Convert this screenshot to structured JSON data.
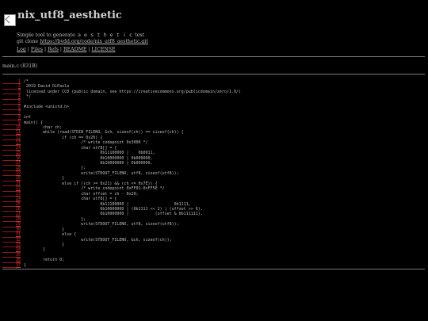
{
  "header": {
    "title": "nix_utf8_aesthetic",
    "description": "Simple tool to generate ａ ｅ ｓ ｔ ｈ ｅ ｔ ｉ ｃ text",
    "clone_prefix": "git clone",
    "clone_url": "https://bvdd.org/code/nix_utf8_aesthetic.git"
  },
  "nav": {
    "items": [
      "Log",
      "Files",
      "Refs",
      "README",
      "LICENSE"
    ]
  },
  "file": {
    "name_size": "main.c (831B)"
  },
  "code_lines": [
    {
      "n": "1",
      "text": "/*"
    },
    {
      "n": "2",
      "text": " 2019 David DiPaola"
    },
    {
      "n": "3",
      "text": " licensed under CC0 (public domain, see https://creativecommons.org/publicdomain/zero/1.0/)"
    },
    {
      "n": "4",
      "text": " */"
    },
    {
      "n": "5",
      "text": ""
    },
    {
      "n": "6",
      "text": "#include <unistd.h>"
    },
    {
      "n": "7",
      "text": ""
    },
    {
      "n": "8",
      "text": "int"
    },
    {
      "n": "9",
      "text": "main() {"
    },
    {
      "n": "10",
      "text": "        char ch;"
    },
    {
      "n": "11",
      "text": "        while (read(STDIN_FILENO, &ch, sizeof(ch)) == sizeof(ch)) {"
    },
    {
      "n": "12",
      "text": "                if (ch == 0x20) {"
    },
    {
      "n": "13",
      "text": "                        /* write codepoint 0x3000 */"
    },
    {
      "n": "14",
      "text": "                        char utf8[] = {"
    },
    {
      "n": "15",
      "text": "                                0b11100000 |    0b0011,"
    },
    {
      "n": "16",
      "text": "                                0b10000000 | 0b000000,"
    },
    {
      "n": "17",
      "text": "                                0b10000000 | 0b000000,"
    },
    {
      "n": "18",
      "text": "                        };"
    },
    {
      "n": "19",
      "text": "                        write(STDOUT_FILENO, utf8, sizeof(utf8));"
    },
    {
      "n": "20",
      "text": "                }"
    },
    {
      "n": "21",
      "text": "                else if ((ch >= 0x21) && (ch <= 0x7E)) {"
    },
    {
      "n": "22",
      "text": "                        /* write codepoint 0xFF01-0xFF5E */"
    },
    {
      "n": "23",
      "text": "                        char offset = ch - 0x20;"
    },
    {
      "n": "24",
      "text": "                        char utf8[] = {"
    },
    {
      "n": "25",
      "text": "                                0b11100000 |                   0b1111,"
    },
    {
      "n": "26",
      "text": "                                0b10000000 | (0b1111 << 2) | (offset >> 6),"
    },
    {
      "n": "27",
      "text": "                                0b10000000 |           (offset & 0b111111),"
    },
    {
      "n": "28",
      "text": "                        };"
    },
    {
      "n": "29",
      "text": "                        write(STDOUT_FILENO, utf8, sizeof(utf8));"
    },
    {
      "n": "30",
      "text": "                }"
    },
    {
      "n": "31",
      "text": "                else {"
    },
    {
      "n": "32",
      "text": "                        write(STDOUT_FILENO, &ch, sizeof(ch));"
    },
    {
      "n": "33",
      "text": "                }"
    },
    {
      "n": "34",
      "text": "        }"
    },
    {
      "n": "35",
      "text": ""
    },
    {
      "n": "36",
      "text": "        return 0;"
    },
    {
      "n": "37",
      "text": "}"
    }
  ]
}
